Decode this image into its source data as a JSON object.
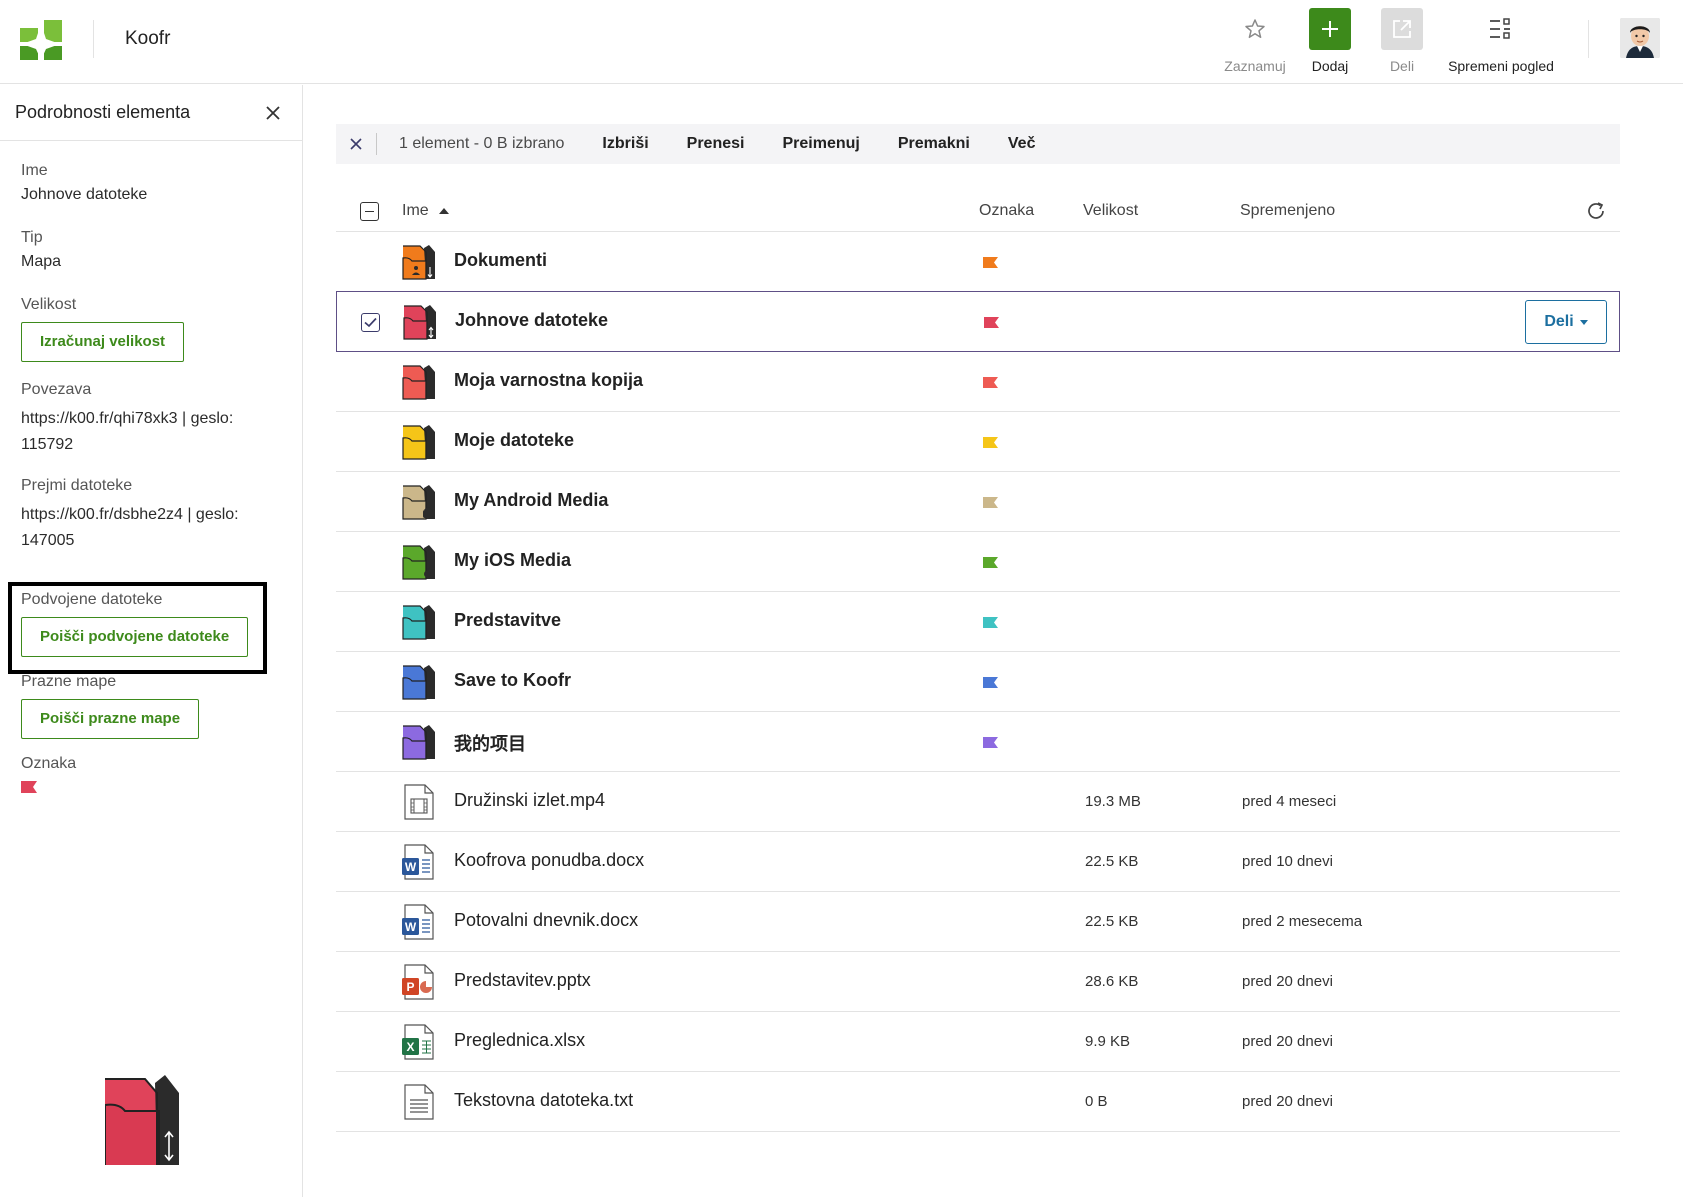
{
  "header": {
    "app_title": "Koofr",
    "buttons": {
      "star": "Zaznamuj",
      "add": "Dodaj",
      "share": "Deli",
      "view": "Spremeni pogled"
    }
  },
  "sidebar": {
    "title": "Podrobnosti elementa",
    "name_label": "Ime",
    "name_value": "Johnove datoteke",
    "type_label": "Tip",
    "type_value": "Mapa",
    "size_label": "Velikost",
    "size_button": "Izračunaj velikost",
    "link_label": "Povezava",
    "link_value_1": "https://k00.fr/qhi78xk3 | geslo:",
    "link_value_2": "115792",
    "receive_label": "Prejmi datoteke",
    "receive_value_1": "https://k00.fr/dsbhe2z4 | geslo:",
    "receive_value_2": "147005",
    "duplicates_label": "Podvojene datoteke",
    "duplicates_button": "Poišči podvojene datoteke",
    "empty_label": "Prazne mape",
    "empty_button": "Poišči prazne mape",
    "tag_label": "Oznaka",
    "tag_color": "#e0435a"
  },
  "toolbar": {
    "count": "1 element - 0 B izbrano",
    "actions": [
      "Izbriši",
      "Prenesi",
      "Preimenuj",
      "Premakni",
      "Več"
    ]
  },
  "table": {
    "headers": {
      "name": "Ime",
      "label": "Oznaka",
      "size": "Velikost",
      "modified": "Spremenjeno"
    },
    "row_share_label": "Deli",
    "rows": [
      {
        "name": "Dokumenti",
        "kind": "folder",
        "color": "#f07b1c",
        "badge": "person-down",
        "size": "",
        "modified": ""
      },
      {
        "name": "Johnove datoteke",
        "kind": "folder",
        "color": "#e0435a",
        "badge": "arrows",
        "size": "",
        "modified": "",
        "selected": true
      },
      {
        "name": "Moja varnostna kopija",
        "kind": "folder",
        "color": "#ee5b53",
        "badge": "",
        "size": "",
        "modified": ""
      },
      {
        "name": "Moje datoteke",
        "kind": "folder",
        "color": "#f5c518",
        "badge": "",
        "size": "",
        "modified": ""
      },
      {
        "name": "My Android Media",
        "kind": "folder",
        "color": "#cbb78a",
        "badge": "android",
        "size": "",
        "modified": ""
      },
      {
        "name": "My iOS Media",
        "kind": "folder",
        "color": "#5ba82b",
        "badge": "apple",
        "size": "",
        "modified": ""
      },
      {
        "name": "Predstavitve",
        "kind": "folder",
        "color": "#3fc2c2",
        "badge": "",
        "size": "",
        "modified": ""
      },
      {
        "name": "Save to Koofr",
        "kind": "folder",
        "color": "#4a78d6",
        "badge": "",
        "size": "",
        "modified": ""
      },
      {
        "name": "我的项目",
        "kind": "folder",
        "color": "#8c6ae0",
        "badge": "",
        "size": "",
        "modified": ""
      },
      {
        "name": "Družinski izlet.mp4",
        "kind": "video",
        "color": "",
        "size": "19.3 MB",
        "modified": "pred 4 meseci"
      },
      {
        "name": "Koofrova ponudba.docx",
        "kind": "word",
        "color": "",
        "size": "22.5 KB",
        "modified": "pred 10 dnevi"
      },
      {
        "name": "Potovalni dnevnik.docx",
        "kind": "word",
        "color": "",
        "size": "22.5 KB",
        "modified": "pred 2 mesecema"
      },
      {
        "name": "Predstavitev.pptx",
        "kind": "powerpoint",
        "color": "",
        "size": "28.6 KB",
        "modified": "pred 20 dnevi"
      },
      {
        "name": "Preglednica.xlsx",
        "kind": "excel",
        "color": "",
        "size": "9.9 KB",
        "modified": "pred 20 dnevi"
      },
      {
        "name": "Tekstovna datoteka.txt",
        "kind": "text",
        "color": "",
        "size": "0 B",
        "modified": "pred 20 dnevi"
      }
    ]
  }
}
